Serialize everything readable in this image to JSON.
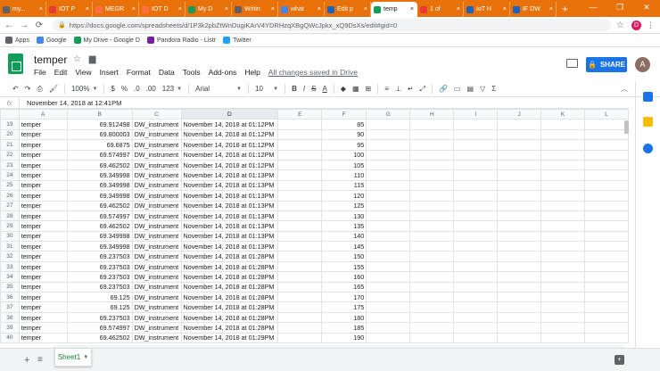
{
  "browser": {
    "tabs": [
      {
        "label": "my...",
        "color": "#5f6368"
      },
      {
        "label": "IOT P",
        "color": "#e53935"
      },
      {
        "label": "MEGR",
        "color": "#ff7043"
      },
      {
        "label": "IOT D",
        "color": "#ff7043"
      },
      {
        "label": "My D",
        "color": "#0f9d58"
      },
      {
        "label": "Writin",
        "color": "#616161"
      },
      {
        "label": "what",
        "color": "#4285f4"
      },
      {
        "label": "Edit p",
        "color": "#1565c0"
      },
      {
        "label": "temp",
        "color": "#0f9d58",
        "active": true
      },
      {
        "label": "1 of",
        "color": "#e53935"
      },
      {
        "label": "IoT H",
        "color": "#1565c0"
      },
      {
        "label": "IF DW",
        "color": "#1565c0"
      }
    ],
    "new_tab": "+",
    "window_controls": [
      "—",
      "❐",
      "✕"
    ],
    "url": "https://docs.google.com/spreadsheets/d/1P3k2pbZtWnDugiKArV4YDRHzqXBgQWcJpkx_xQ9DsXs/edit#gid=0",
    "profile_initial": "D",
    "bookmarks": [
      {
        "label": "Apps",
        "color": "#5f6368"
      },
      {
        "label": "Google",
        "color": "#4285f4"
      },
      {
        "label": "My Drive - Google D",
        "color": "#0f9d58"
      },
      {
        "label": "Pandora Radio - Listr",
        "color": "#7b1fa2"
      },
      {
        "label": "Twitter",
        "color": "#1da1f2"
      }
    ]
  },
  "sheets": {
    "doc_title": "temper",
    "menu": [
      "File",
      "Edit",
      "View",
      "Insert",
      "Format",
      "Data",
      "Tools",
      "Add-ons",
      "Help"
    ],
    "saved_status": "All changes saved in Drive",
    "share_label": "SHARE",
    "user_initial": "A",
    "toolbar": {
      "zoom": "100%",
      "currency": "$",
      "percent": "%",
      "decimals_less": ".0",
      "decimals_more": ".00",
      "number_format": "123",
      "font": "Arial",
      "font_size": "10",
      "bold": "B",
      "italic": "I",
      "strike": "S",
      "text_color": "A"
    },
    "fx_label": "fx",
    "formula_value": "November 14, 2018 at 12:41PM",
    "columns": [
      "A",
      "B",
      "C",
      "D",
      "E",
      "F",
      "G",
      "H",
      "I",
      "J",
      "K",
      "L"
    ],
    "selected_column": "D",
    "rows": [
      {
        "n": "19",
        "a": "temper",
        "b": "69.912498",
        "c": "DW_instrument",
        "d": "November 14, 2018 at 01:12PM",
        "f": "85"
      },
      {
        "n": "20",
        "a": "temper",
        "b": "69.800003",
        "c": "DW_instrument",
        "d": "November 14, 2018 at 01:12PM",
        "f": "90"
      },
      {
        "n": "21",
        "a": "temper",
        "b": "69.6875",
        "c": "DW_instrument",
        "d": "November 14, 2018 at 01:12PM",
        "f": "95"
      },
      {
        "n": "22",
        "a": "temper",
        "b": "69.574997",
        "c": "DW_instrument",
        "d": "November 14, 2018 at 01:12PM",
        "f": "100"
      },
      {
        "n": "23",
        "a": "temper",
        "b": "69.462502",
        "c": "DW_instrument",
        "d": "November 14, 2018 at 01:12PM",
        "f": "105"
      },
      {
        "n": "24",
        "a": "temper",
        "b": "69.349998",
        "c": "DW_instrument",
        "d": "November 14, 2018 at 01:13PM",
        "f": "110"
      },
      {
        "n": "25",
        "a": "temper",
        "b": "69.349998",
        "c": "DW_instrument",
        "d": "November 14, 2018 at 01:13PM",
        "f": "115"
      },
      {
        "n": "26",
        "a": "temper",
        "b": "69.349998",
        "c": "DW_instrument",
        "d": "November 14, 2018 at 01:13PM",
        "f": "120"
      },
      {
        "n": "27",
        "a": "temper",
        "b": "69.462502",
        "c": "DW_instrument",
        "d": "November 14, 2018 at 01:13PM",
        "f": "125"
      },
      {
        "n": "28",
        "a": "temper",
        "b": "69.574997",
        "c": "DW_instrument",
        "d": "November 14, 2018 at 01:13PM",
        "f": "130"
      },
      {
        "n": "29",
        "a": "temper",
        "b": "69.462502",
        "c": "DW_instrument",
        "d": "November 14, 2018 at 01:13PM",
        "f": "135"
      },
      {
        "n": "30",
        "a": "temper",
        "b": "69.349998",
        "c": "DW_instrument",
        "d": "November 14, 2018 at 01:13PM",
        "f": "140"
      },
      {
        "n": "31",
        "a": "temper",
        "b": "69.349998",
        "c": "DW_instrument",
        "d": "November 14, 2018 at 01:13PM",
        "f": "145"
      },
      {
        "n": "32",
        "a": "temper",
        "b": "69.237503",
        "c": "DW_instrument",
        "d": "November 14, 2018 at 01:28PM",
        "f": "150"
      },
      {
        "n": "33",
        "a": "temper",
        "b": "69.237503",
        "c": "DW_instrument",
        "d": "November 14, 2018 at 01:28PM",
        "f": "155"
      },
      {
        "n": "34",
        "a": "temper",
        "b": "69.237503",
        "c": "DW_instrument",
        "d": "November 14, 2018 at 01:28PM",
        "f": "160"
      },
      {
        "n": "35",
        "a": "temper",
        "b": "69.237503",
        "c": "DW_instrument",
        "d": "November 14, 2018 at 01:28PM",
        "f": "165"
      },
      {
        "n": "36",
        "a": "temper",
        "b": "69.125",
        "c": "DW_instrument",
        "d": "November 14, 2018 at 01:28PM",
        "f": "170"
      },
      {
        "n": "37",
        "a": "temper",
        "b": "69.125",
        "c": "DW_instrument",
        "d": "November 14, 2018 at 01:28PM",
        "f": "175"
      },
      {
        "n": "38",
        "a": "temper",
        "b": "69.237503",
        "c": "DW_instrument",
        "d": "November 14, 2018 at 01:28PM",
        "f": "180"
      },
      {
        "n": "39",
        "a": "temper",
        "b": "69.574997",
        "c": "DW_instrument",
        "d": "November 14, 2018 at 01:28PM",
        "f": "185"
      },
      {
        "n": "40",
        "a": "temper",
        "b": "69.462502",
        "c": "DW_instrument",
        "d": "November 14, 2018 at 01:29PM",
        "f": "190"
      }
    ],
    "sheet_tabs": [
      "Sheet1"
    ],
    "accent": "#0f9d58",
    "share_color": "#1a73e8"
  }
}
